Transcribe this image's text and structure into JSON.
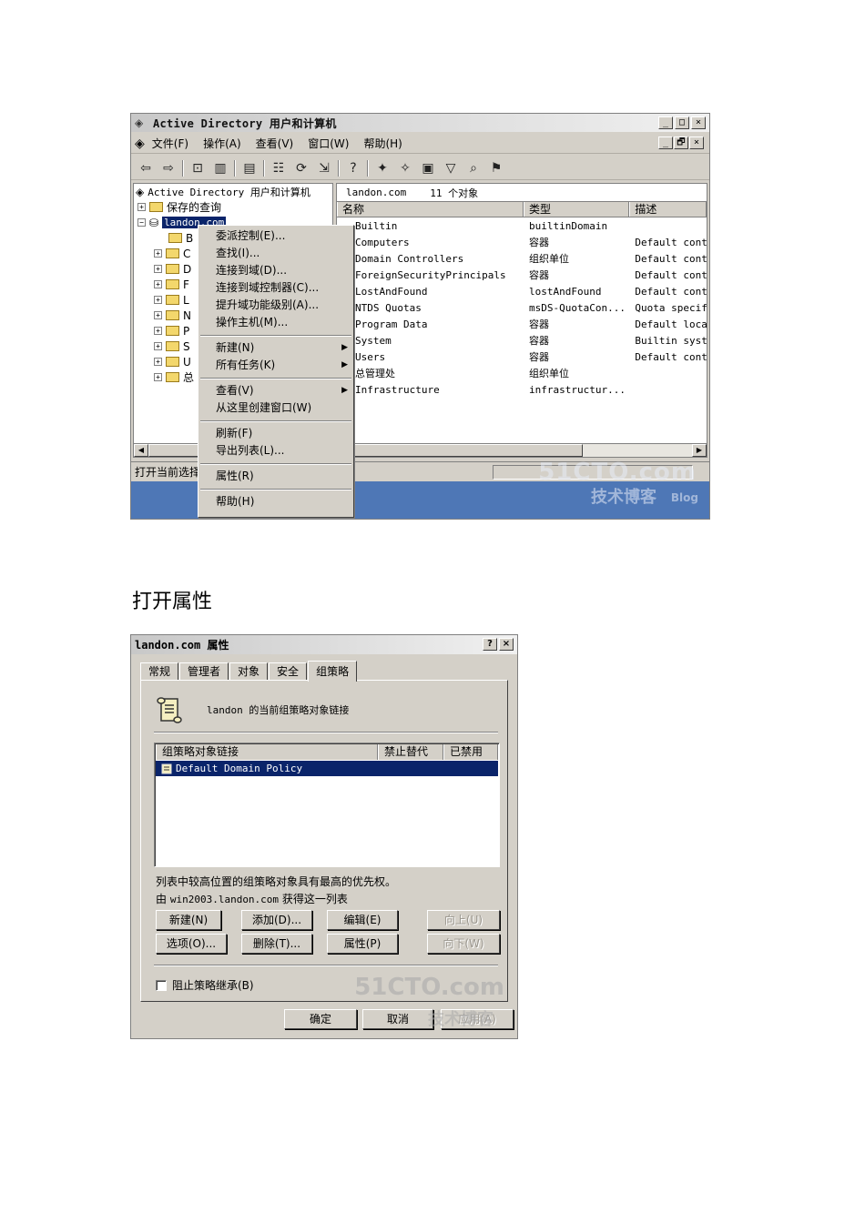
{
  "aduc": {
    "title": "Active Directory 用户和计算机",
    "window_buttons": [
      "_",
      "□",
      "×"
    ],
    "inner_buttons": [
      "_",
      "🗗",
      "×"
    ],
    "menu": [
      "文件(F)",
      "操作(A)",
      "查看(V)",
      "窗口(W)",
      "帮助(H)"
    ],
    "tree": {
      "root": "Active Directory 用户和计算机",
      "saved_queries": "保存的查询",
      "domain": "landon.com",
      "children": [
        "B",
        "C",
        "D",
        "F",
        "L",
        "N",
        "P",
        "S",
        "U",
        "总"
      ]
    },
    "list": {
      "path": "landon.com",
      "count": "11 个对象",
      "columns": [
        "名称",
        "类型",
        "描述"
      ],
      "rows": [
        {
          "name": "Builtin",
          "type": "builtinDomain",
          "desc": ""
        },
        {
          "name": "Computers",
          "type": "容器",
          "desc": "Default cont"
        },
        {
          "name": "Domain Controllers",
          "type": "组织单位",
          "desc": "Default cont"
        },
        {
          "name": "ForeignSecurityPrincipals",
          "type": "容器",
          "desc": "Default cont"
        },
        {
          "name": "LostAndFound",
          "type": "lostAndFound",
          "desc": "Default cont"
        },
        {
          "name": "NTDS Quotas",
          "type": "msDS-QuotaCon...",
          "desc": "Quota specif"
        },
        {
          "name": "Program Data",
          "type": "容器",
          "desc": "Default loca"
        },
        {
          "name": "System",
          "type": "容器",
          "desc": "Builtin syst"
        },
        {
          "name": "Users",
          "type": "容器",
          "desc": "Default cont"
        },
        {
          "name": "总管理处",
          "type": "组织单位",
          "desc": ""
        },
        {
          "name": "Infrastructure",
          "type": "infrastructur...",
          "desc": ""
        }
      ]
    },
    "context_menu": {
      "group1": [
        "委派控制(E)...",
        "查找(I)...",
        "连接到域(D)...",
        "连接到域控制器(C)...",
        "提升域功能级别(A)...",
        "操作主机(M)..."
      ],
      "group2": [
        "新建(N)",
        "所有任务(K)"
      ],
      "group3": [
        "查看(V)",
        "从这里创建窗口(W)"
      ],
      "group4": [
        "刷新(F)",
        "导出列表(L)..."
      ],
      "group5": [
        "属性(R)"
      ],
      "group6": [
        "帮助(H)"
      ]
    },
    "status": "打开当前选择",
    "watermark_main": "51CTO.com",
    "watermark_sub": "技术博客",
    "watermark_blog": "Blog"
  },
  "caption": "打开属性",
  "props": {
    "title": "landon.com 属性",
    "title_buttons": [
      "?",
      "×"
    ],
    "tabs": [
      "常规",
      "管理者",
      "对象",
      "安全",
      "组策略"
    ],
    "active_tab": "组策略",
    "header": "landon 的当前组策略对象链接",
    "columns": [
      "组策略对象链接",
      "禁止替代",
      "已禁用"
    ],
    "selected_gpo": "Default Domain Policy",
    "note1": "列表中较高位置的组策略对象具有最高的优先权。",
    "note2_prefix": "由",
    "note2_host": "win2003.landon.com",
    "note2_suffix": "获得这一列表",
    "buttons": {
      "new": "新建(N)",
      "add": "添加(D)...",
      "edit": "编辑(E)",
      "up": "向上(U)",
      "options": "选项(O)...",
      "delete": "删除(T)...",
      "properties": "属性(P)",
      "down": "向下(W)"
    },
    "block_inheritance": "阻止策略继承(B)",
    "ok": "确定",
    "cancel": "取消",
    "apply": "应用(A)",
    "watermark_main": "51CTO.com",
    "watermark_sub": "技术博客"
  }
}
